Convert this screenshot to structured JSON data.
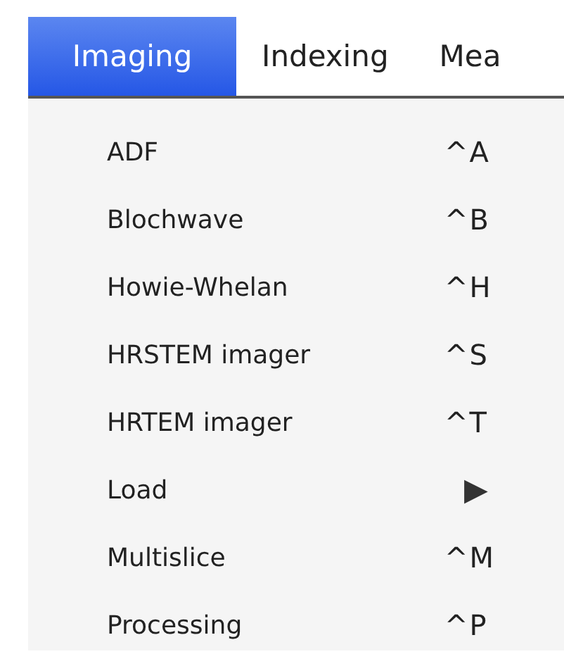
{
  "menubar": [
    {
      "label": "Imaging",
      "selected": true
    },
    {
      "label": "Indexing",
      "selected": false
    },
    {
      "label": "Mea",
      "selected": false
    }
  ],
  "menu": {
    "items": [
      {
        "label": "ADF",
        "shortcut": "^A"
      },
      {
        "label": "Blochwave",
        "shortcut": "^B"
      },
      {
        "label": "Howie-Whelan",
        "shortcut": "^H"
      },
      {
        "label": "HRSTEM imager",
        "shortcut": "^S"
      },
      {
        "label": "HRTEM imager",
        "shortcut": "^T"
      },
      {
        "label": "Load",
        "submenu": "▶"
      },
      {
        "label": "Multislice",
        "shortcut": "^M"
      },
      {
        "label": "Processing",
        "shortcut": "^P"
      }
    ]
  }
}
